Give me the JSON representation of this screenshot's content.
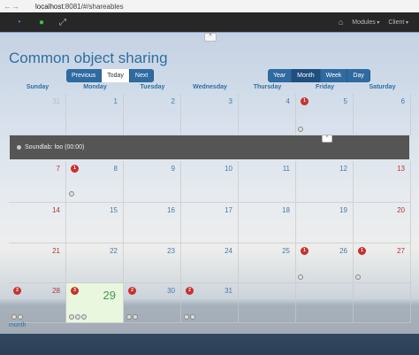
{
  "browser": {
    "url_host": "localhost",
    "url_rest": ":8081/#/shareables"
  },
  "nav": {
    "modules": "Modules",
    "client": "Client"
  },
  "page": {
    "title": "Common object sharing",
    "collapse_glyph": "^"
  },
  "nav_buttons": {
    "previous": "Previous",
    "today": "Today",
    "next": "Next"
  },
  "view_buttons": {
    "year": "Year",
    "month": "Month",
    "week": "Week",
    "day": "Day"
  },
  "weekdays": [
    "Sunday",
    "Monday",
    "Tuesday",
    "Wednesday",
    "Thursday",
    "Friday",
    "Saturday"
  ],
  "weeks": [
    [
      "31",
      "1",
      "2",
      "3",
      "4",
      "5",
      "6"
    ],
    [
      "7",
      "8",
      "9",
      "10",
      "11",
      "12",
      "13"
    ],
    [
      "14",
      "15",
      "16",
      "17",
      "18",
      "19",
      "20"
    ],
    [
      "21",
      "22",
      "23",
      "24",
      "25",
      "26",
      "27"
    ],
    [
      "28",
      "29",
      "30",
      "31",
      "",
      "",
      ""
    ]
  ],
  "badges": {
    "w0_thursday": "1",
    "w1_sunday": "1",
    "w3_thursday": "1",
    "w3_friday": "1",
    "w4_sunday": "2",
    "w4_monday": "3",
    "w4_tuesday": "2",
    "w4_wednesday": "2"
  },
  "event": {
    "label": "Soundlab: foo (00:00)",
    "toggle_glyph": "^"
  },
  "footer": {
    "month_link": "month"
  }
}
